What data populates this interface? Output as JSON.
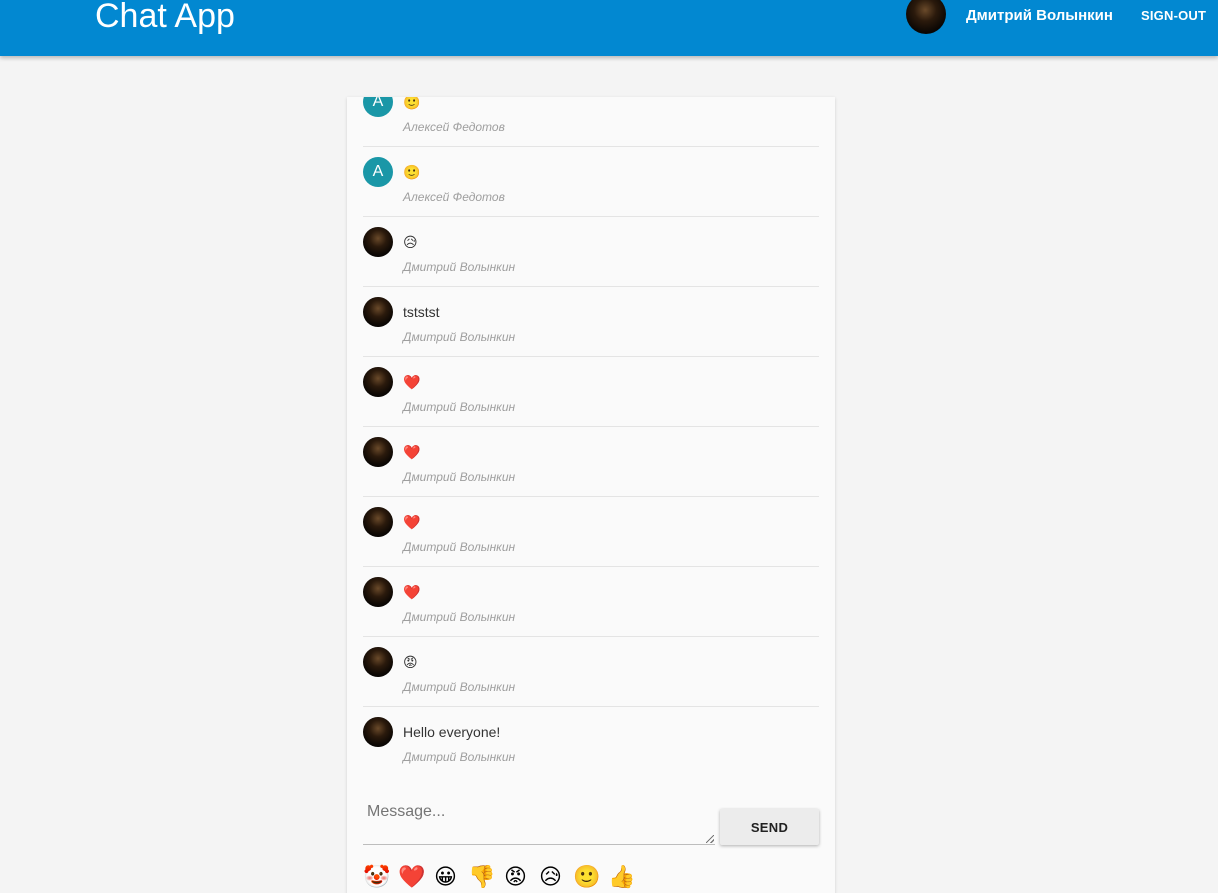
{
  "header": {
    "title": "Chat App",
    "user_name": "Дмитрий Волынкин",
    "signout_label": "SIGN-OUT",
    "background_color": "#0288d1"
  },
  "messages": [
    {
      "author": "Алексей Федотов",
      "text": "🙂",
      "avatar_letter": "А",
      "avatar_type": "letter"
    },
    {
      "author": "Алексей Федотов",
      "text": "🙂",
      "avatar_letter": "А",
      "avatar_type": "letter"
    },
    {
      "author": "Дмитрий Волынкин",
      "text": "😥",
      "avatar_type": "photo"
    },
    {
      "author": "Дмитрий Волынкин",
      "text": "tststst",
      "avatar_type": "photo"
    },
    {
      "author": "Дмитрий Волынкин",
      "text": "❤️",
      "avatar_type": "photo"
    },
    {
      "author": "Дмитрий Волынкин",
      "text": "❤️",
      "avatar_type": "photo"
    },
    {
      "author": "Дмитрий Волынкин",
      "text": "❤️",
      "avatar_type": "photo"
    },
    {
      "author": "Дмитрий Волынкин",
      "text": "❤️",
      "avatar_type": "photo"
    },
    {
      "author": "Дмитрий Волынкин",
      "text": "😡",
      "avatar_type": "photo"
    },
    {
      "author": "Дмитрий Волынкин",
      "text": "Hello everyone!",
      "avatar_type": "photo"
    }
  ],
  "composer": {
    "placeholder": "Message...",
    "value": "",
    "send_label": "SEND"
  },
  "emojis": [
    {
      "char": "🤡",
      "name": "clown-face"
    },
    {
      "char": "❤️",
      "name": "red-heart"
    },
    {
      "char": "😀",
      "name": "grinning-face"
    },
    {
      "char": "👎",
      "name": "thumbs-down"
    },
    {
      "char": "😡",
      "name": "angry-face"
    },
    {
      "char": "😥",
      "name": "sad-face"
    },
    {
      "char": "🙂",
      "name": "slightly-smiling-face"
    },
    {
      "char": "👍",
      "name": "thumbs-up"
    }
  ]
}
